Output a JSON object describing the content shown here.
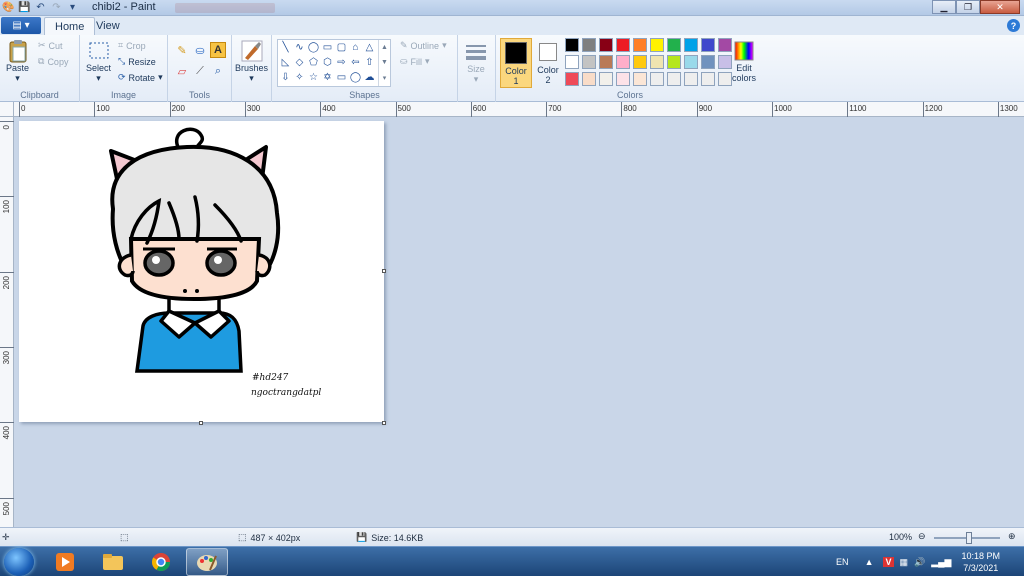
{
  "window": {
    "title": "chibi2 - Paint",
    "controls": [
      "minimize",
      "restore",
      "close"
    ]
  },
  "tabs": [
    {
      "label": "Home",
      "active": true
    },
    {
      "label": "View",
      "active": false
    }
  ],
  "ribbon": {
    "clipboard": {
      "label": "Clipboard",
      "paste": "Paste",
      "cut": "Cut",
      "copy": "Copy"
    },
    "image": {
      "label": "Image",
      "select": "Select",
      "crop": "Crop",
      "resize": "Resize",
      "rotate": "Rotate"
    },
    "tools": {
      "label": "Tools"
    },
    "brushes": {
      "label": "Brushes"
    },
    "shapes": {
      "label": "Shapes",
      "outline": "Outline",
      "fill": "Fill"
    },
    "size": {
      "label": "Size"
    },
    "colors": {
      "label": "Colors",
      "color1": "Color",
      "color1_num": "1",
      "color2": "Color",
      "color2_num": "2",
      "edit_colors_1": "Edit",
      "edit_colors_2": "colors",
      "color1_value": "#000000",
      "color2_value": "#ffffff",
      "palette_row1": [
        "#000000",
        "#7f7f7f",
        "#880015",
        "#ed1c24",
        "#ff7f27",
        "#fff200",
        "#22b14c",
        "#00a2e8",
        "#3f48cc",
        "#a349a4"
      ],
      "palette_row2": [
        "#ffffff",
        "#c3c3c3",
        "#b97a57",
        "#ffaec9",
        "#ffc90e",
        "#efe4b0",
        "#b5e61d",
        "#99d9ea",
        "#7092be",
        "#c8bfe7"
      ],
      "palette_row3": [
        "#ef4a58",
        "#f9dcc8",
        "#f2f0eb",
        "#fde2e8",
        "#fbe6d6",
        "#eeeeee",
        "#eeeeee",
        "#eeeeee",
        "#eeeeee",
        "#eeeeee"
      ]
    }
  },
  "ruler": {
    "h_ticks": [
      "0",
      "100",
      "200",
      "300",
      "400",
      "500",
      "600",
      "700",
      "800",
      "900",
      "1000",
      "1100",
      "1200",
      "1300"
    ],
    "v_ticks": [
      "0",
      "100",
      "200",
      "300",
      "400",
      "500"
    ]
  },
  "canvas": {
    "signature_line1": "#hd247",
    "signature_line2": "ngoctrangdatpl"
  },
  "status": {
    "dimensions": "487 × 402px",
    "size": "Size: 14.6KB",
    "zoom": "100%"
  },
  "taskbar": {
    "language": "EN",
    "time": "10:18 PM",
    "date": "7/3/2021"
  }
}
